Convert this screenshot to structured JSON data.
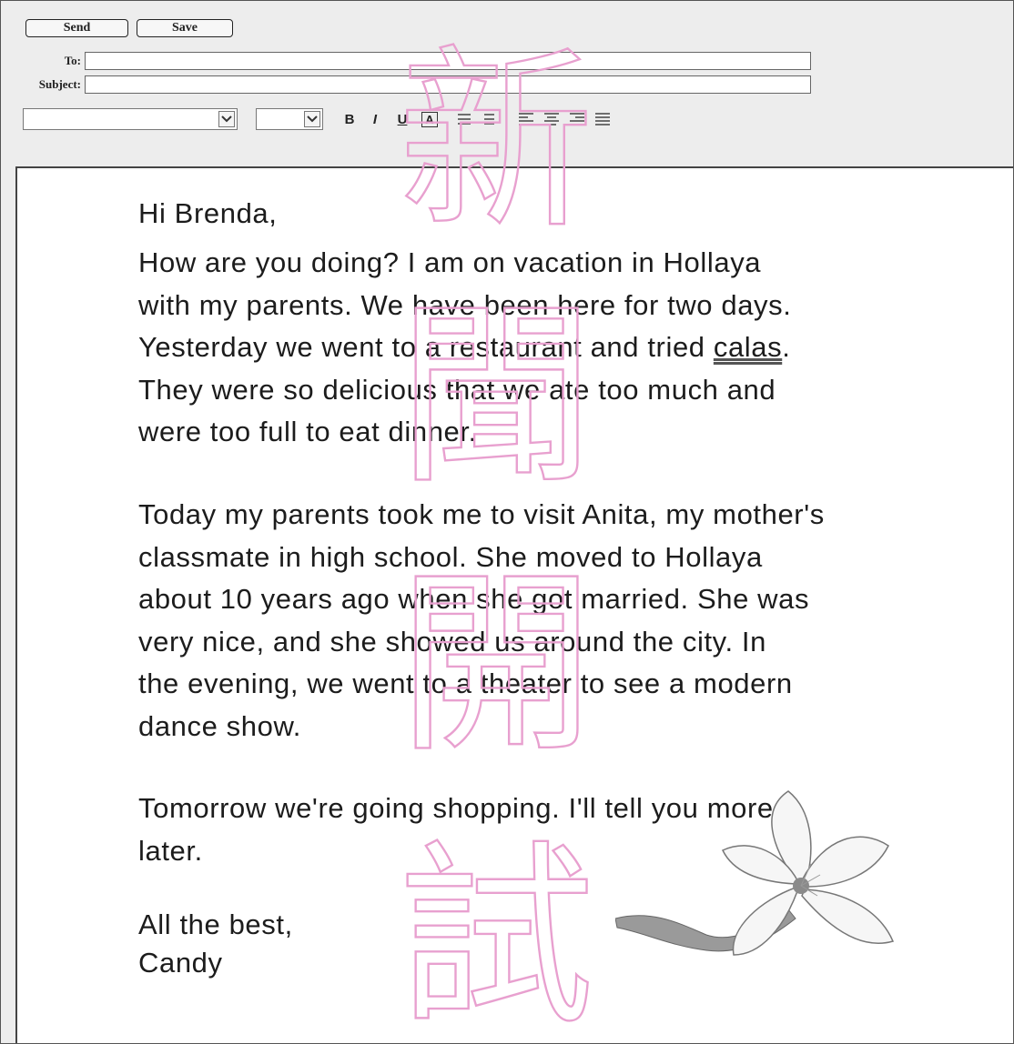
{
  "toolbar": {
    "send_label": "Send",
    "save_label": "Save"
  },
  "fields": {
    "to_label": "To:",
    "to_value": "",
    "subject_label": "Subject:",
    "subject_value": ""
  },
  "formatting": {
    "font_select_value": "",
    "size_select_value": "",
    "bold": "B",
    "italic": "I",
    "underline": "U",
    "text_color": "A",
    "icons": [
      "numbered-list-icon",
      "bullet-list-icon",
      "align-left-icon",
      "align-center-icon",
      "align-right-icon",
      "justify-icon"
    ]
  },
  "message": {
    "greeting": "Hi Brenda,",
    "p1": [
      "How are you doing?  I am on vacation in Hollaya",
      "with my parents.  We have been here for two days.",
      "Yesterday we went to a restaurant and tried ",
      "They were so delicious that we ate too much and",
      "were too full to eat dinner."
    ],
    "underlined_word": "calas",
    "after_underlined": ".",
    "p2": [
      "Today my parents took me to visit  Anita, my mother's",
      "classmate in high school.  She moved to Hollaya",
      "about 10 years ago when she got married.  She was",
      "very nice, and she showed us around the city.   In",
      "the evening, we went to a theater to see a modern",
      "dance show."
    ],
    "p3": [
      "Tomorrow we're going shopping.  I'll tell you more",
      "later."
    ],
    "closing": "All the best,",
    "signature": "Candy"
  },
  "watermark": {
    "chars": [
      "新",
      "聞",
      "開",
      "試"
    ],
    "color": "#e8a0cf"
  },
  "colors": {
    "toolbar_bg": "#ededed",
    "body_bg": "#ffffff",
    "text": "#1c1c1c"
  }
}
